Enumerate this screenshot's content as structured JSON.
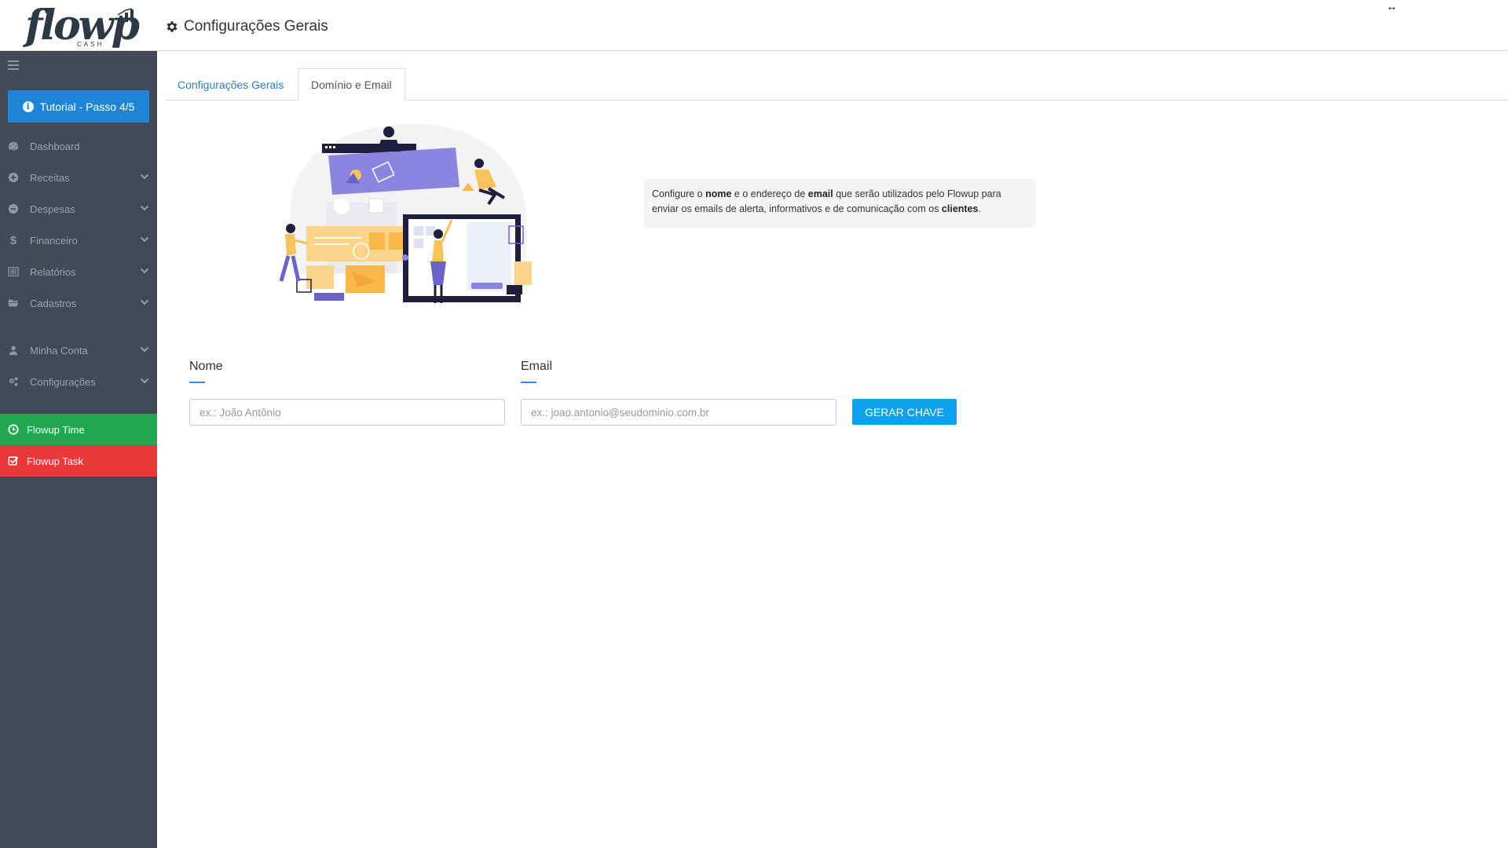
{
  "header": {
    "logo_text": "flowp",
    "logo_sub": "CASH",
    "title": "Configurações Gerais",
    "title_icon": "gear-icon",
    "resize_glyph": "↔"
  },
  "sidebar": {
    "tutorial_label": "Tutorial - Passo 4/5",
    "items": [
      {
        "label": "Dashboard",
        "icon": "dashboard-icon"
      },
      {
        "label": "Receitas",
        "icon": "plus-circle-icon"
      },
      {
        "label": "Despesas",
        "icon": "minus-circle-icon"
      },
      {
        "label": "Financeiro",
        "icon": "dollar-icon"
      },
      {
        "label": "Relatórios",
        "icon": "list-icon"
      },
      {
        "label": "Cadastros",
        "icon": "folder-icon"
      },
      {
        "label": "Minha Conta",
        "icon": "user-icon"
      },
      {
        "label": "Configurações",
        "icon": "cogs-icon"
      }
    ],
    "apps": [
      {
        "label": "Flowup Time",
        "color": "#1fa84f"
      },
      {
        "label": "Flowup Task",
        "color": "#e83a3a"
      }
    ]
  },
  "tabs": [
    {
      "label": "Configurações Gerais",
      "active": false
    },
    {
      "label": "Domínio e Email",
      "active": true
    }
  ],
  "info": {
    "p1": "Configure o ",
    "b1": "nome",
    "p2": " e o endereço de ",
    "b2": "email",
    "p3": " que serão utilizados pelo Flowup para enviar os emails de alerta, informativos e de comunicação com os ",
    "b3": "clientes",
    "p4": "."
  },
  "form": {
    "nome_label": "Nome",
    "nome_placeholder": "ex.: João Antônio",
    "email_label": "Email",
    "email_placeholder": "ex.: joao.antonio@seudominio.com.br",
    "generate_label": "GERAR CHAVE"
  },
  "colors": {
    "sidebar_bg": "#444a55",
    "primary": "#1e84d6",
    "button": "#0ea0ec",
    "tab_link": "#337ab7"
  }
}
